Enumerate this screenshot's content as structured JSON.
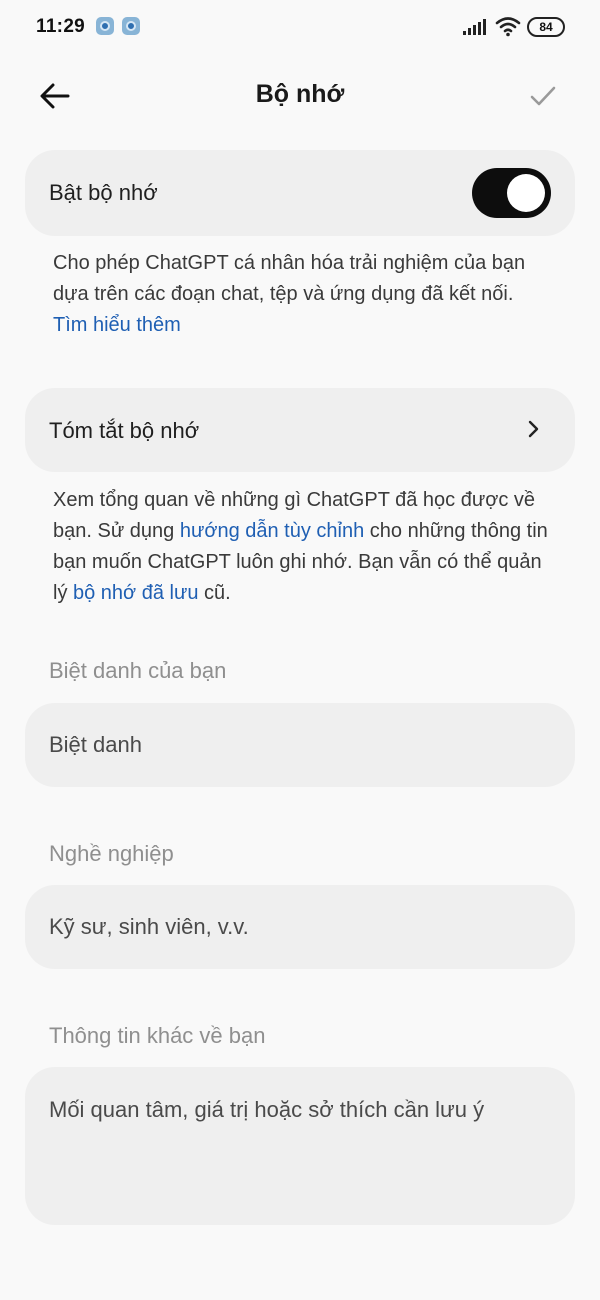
{
  "status_bar": {
    "time": "11:29",
    "battery": "84",
    "icons": [
      "notification-app-icon",
      "notification-app-icon",
      "signal-icon",
      "wifi-icon",
      "battery-icon"
    ]
  },
  "header": {
    "title": "Bộ nhớ",
    "back_icon": "arrow-left-icon",
    "confirm_icon": "check-icon"
  },
  "memory_toggle": {
    "label": "Bật bộ nhớ",
    "enabled": true
  },
  "memory_description": {
    "text": " Cho phép ChatGPT cá nhân hóa trải nghiệm của bạn dựa trên các đoạn chat, tệp và ứng dụng đã kết nối. ",
    "link": "Tìm hiểu thêm"
  },
  "memory_summary": {
    "label": "Tóm tắt bộ nhớ",
    "icon": "chevron-right-icon"
  },
  "summary_description": {
    "part1": " Xem tổng quan về những gì ChatGPT đã học được về bạn. Sử dụng ",
    "link1": "hướng dẫn tùy chỉnh",
    "part2": " cho những thông tin bạn muốn ChatGPT luôn ghi nhớ. Bạn vẫn có thể quản lý ",
    "link2": "bộ nhớ đã lưu",
    "part3": " cũ."
  },
  "nickname": {
    "section_label": "Biệt danh của bạn",
    "placeholder": "Biệt danh"
  },
  "occupation": {
    "section_label": "Nghề nghiệp",
    "placeholder": "Kỹ sư, sinh viên, v.v."
  },
  "more_about_you": {
    "section_label": "Thông tin khác về bạn",
    "placeholder": "Mối quan tâm, giá trị hoặc sở thích cần lưu ý"
  },
  "colors": {
    "background": "#f9f9f9",
    "card": "#efefef",
    "link": "#1f5fb3",
    "toggle_on": "#0d0d0d"
  }
}
